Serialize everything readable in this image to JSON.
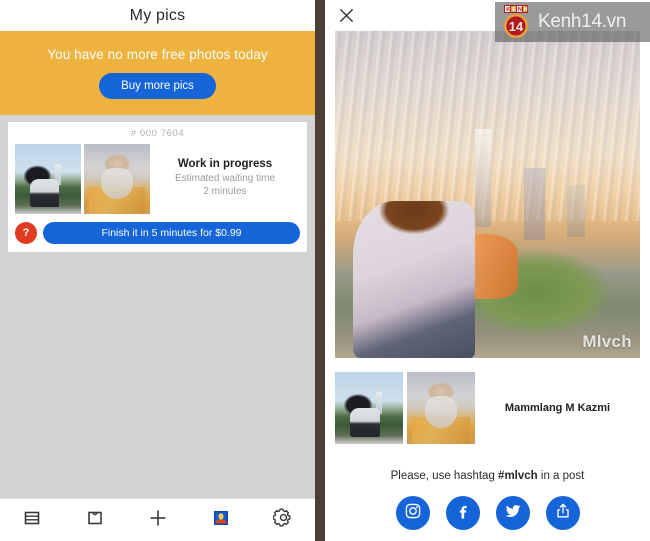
{
  "left": {
    "header": {
      "title": "My pics"
    },
    "promo": {
      "message": "You have no more free photos today",
      "button_label": "Buy more pics",
      "bg_color": "#edb33e",
      "button_color": "#1565d8"
    },
    "card": {
      "job_id": "# 000 7604",
      "status": "Work in progress",
      "wait_label": "Estimated waiting time",
      "wait_value": "2 minutes",
      "help_badge": "?",
      "finish_label": "Finish it in 5 minutes for $0.99",
      "thumb_original_name": "original-photo-thumbnail",
      "thumb_result_name": "styled-photo-thumbnail"
    },
    "tabbar": {
      "items": [
        {
          "name": "feed",
          "icon": "feed-icon",
          "active": false
        },
        {
          "name": "inbox",
          "icon": "inbox-icon",
          "active": false
        },
        {
          "name": "add",
          "icon": "plus-icon",
          "active": false
        },
        {
          "name": "my-pics",
          "icon": "portrait-photo-icon",
          "active": true
        },
        {
          "name": "settings",
          "icon": "gear-icon",
          "active": false
        }
      ]
    }
  },
  "right": {
    "header": {
      "close_icon": "close-icon"
    },
    "artwork": {
      "watermark": "Mlvch",
      "alt": "watercolor painting of a man sitting and looking at a city skyline"
    },
    "result": {
      "name": "Mammlang M Kazmi",
      "thumb_original_name": "original-photo-thumbnail",
      "thumb_result_name": "styled-photo-thumbnail"
    },
    "hashtag": {
      "prefix": "Please, use hashtag ",
      "tag": "#mlvch",
      "suffix": " in a post"
    },
    "social": {
      "buttons": [
        {
          "name": "instagram",
          "icon": "instagram-icon"
        },
        {
          "name": "facebook",
          "icon": "facebook-icon"
        },
        {
          "name": "twitter",
          "icon": "twitter-icon"
        },
        {
          "name": "share",
          "icon": "share-icon"
        }
      ],
      "color": "#1565d8"
    }
  },
  "watermark": {
    "site": "Kenh14.vn",
    "logo_top": "KENH",
    "logo_number": "14"
  }
}
